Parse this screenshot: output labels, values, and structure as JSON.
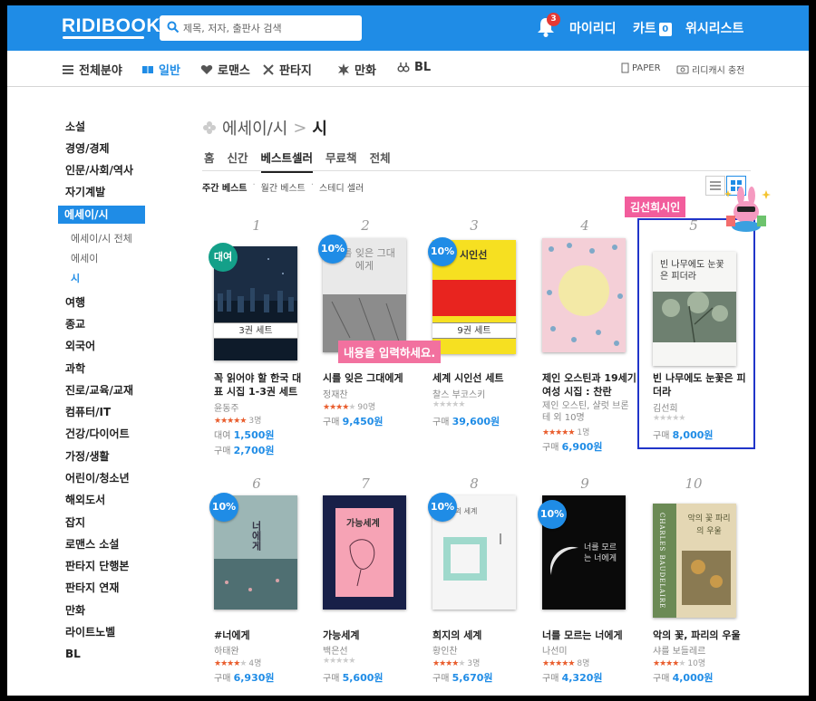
{
  "header": {
    "logo": "RIDIBOOKS",
    "search_placeholder": "제목, 저자, 출판사 검색",
    "notification_count": "3",
    "my_ridi": "마이리디",
    "cart_label": "카트",
    "cart_count": "0",
    "wishlist": "위시리스트"
  },
  "nav": {
    "items": [
      "전체분야",
      "일반",
      "로맨스",
      "판타지",
      "만화",
      "BL"
    ],
    "active": "일반",
    "paper": "PAPER",
    "charge": "리디캐시 충전"
  },
  "sidebar": {
    "categories_top": [
      "소설",
      "경영/경제",
      "인문/사회/역사",
      "자기계발"
    ],
    "active": "에세이/시",
    "sub": [
      "에세이/시 전체",
      "에세이",
      "시"
    ],
    "sub_active": "시",
    "categories_bottom": [
      "여행",
      "종교",
      "외국어",
      "과학",
      "진로/교육/교재",
      "컴퓨터/IT",
      "건강/다이어트",
      "가정/생활",
      "어린이/청소년",
      "해외도서",
      "잡지",
      "로맨스 소설",
      "판타지 단행본",
      "판타지 연재",
      "만화",
      "라이트노벨",
      "BL"
    ]
  },
  "main": {
    "breadcrumb_parent": "에세이/시",
    "breadcrumb_sep": ">",
    "breadcrumb_current": "시",
    "tabs": [
      "홈",
      "신간",
      "베스트셀러",
      "무료책",
      "전체"
    ],
    "active_tab": "베스트셀러",
    "subtabs": [
      "주간 베스트",
      "월간 베스트",
      "스테디 셀러"
    ],
    "subtab_sep": "·"
  },
  "overlays": {
    "name_tag": "김선희시인",
    "input_tag": "내용을 입력하세요."
  },
  "books": [
    {
      "rank": "1",
      "title": "꼭 읽어야 할 한국 대표 시집 1-3권 세트",
      "author": "윤동주",
      "rating": 5,
      "count": "3명",
      "rent_label": "대여",
      "rent_price": "1,500원",
      "buy_label": "구매",
      "price": "2,700원",
      "badge": "대여",
      "set": "3권 세트",
      "cover_color": "#1b2d44"
    },
    {
      "rank": "2",
      "title": "시를 잊은 그대에게",
      "author": "정재찬",
      "rating": 4,
      "count": "90명",
      "buy_label": "구매",
      "price": "9,450원",
      "badge": "10%",
      "cover_color": "#d9d9d9",
      "cover_title": "시를 잊은 그대에게"
    },
    {
      "rank": "3",
      "title": "세계 시인선 세트",
      "author": "찰스 부코스키",
      "rating": 0,
      "count": "",
      "buy_label": "구매",
      "price": "39,600원",
      "badge": "10%",
      "set": "9권 세트",
      "cover_color": "#f6e021",
      "cover_title": "시인선"
    },
    {
      "rank": "4",
      "title": "제인 오스틴과 19세기 여성 시집 : 찬란",
      "author": "제인 오스틴, 샬럿 브론테 외 10명",
      "rating": 5,
      "count": "1명",
      "buy_label": "구매",
      "price": "6,900원",
      "cover_color": "#f1c6cf"
    },
    {
      "rank": "5",
      "title": "빈 나무에도 눈꽃은 피더라",
      "author": "김선희",
      "rating": 0,
      "count": "",
      "buy_label": "구매",
      "price": "8,000원",
      "cover_color": "#f4f4f2",
      "cover_title": "빈 나무에도 눈꽃은 피더라"
    },
    {
      "rank": "6",
      "title": "#너에게",
      "author": "하태완",
      "rating": 4,
      "count": "4명",
      "buy_label": "구매",
      "price": "6,930원",
      "badge": "10%",
      "cover_color": "#5b7f84",
      "cover_title": "너에게"
    },
    {
      "rank": "7",
      "title": "가능세계",
      "author": "백은선",
      "rating": 0,
      "count": "",
      "buy_label": "구매",
      "price": "5,600원",
      "cover_color": "#182048",
      "cover_title": "가능세계"
    },
    {
      "rank": "8",
      "title": "희지의 세계",
      "author": "황인찬",
      "rating": 4,
      "count": "3명",
      "buy_label": "구매",
      "price": "5,670원",
      "badge": "10%",
      "cover_color": "#f5f5f5",
      "cover_title": "희지의 세계"
    },
    {
      "rank": "9",
      "title": "너를 모르는 너에게",
      "author": "나선미",
      "rating": 5,
      "count": "8명",
      "buy_label": "구매",
      "price": "4,320원",
      "badge": "10%",
      "cover_color": "#0a0a0a",
      "cover_title": "너를 모르는 너에게"
    },
    {
      "rank": "10",
      "title": "악의 꽃, 파리의 우울",
      "author": "샤를 보들레르",
      "rating": 4,
      "count": "10명",
      "buy_label": "구매",
      "price": "4,000원",
      "cover_color": "#d8c9a4",
      "cover_title": "악의 꽃 파리의 우울",
      "cover_author": "CHARLES BAUDELAIRE"
    }
  ],
  "colors": {
    "accent": "#1f8ce6",
    "star": "#e95d2d",
    "highlight": "#2035c9",
    "tag_pink": "#f25d9c"
  }
}
